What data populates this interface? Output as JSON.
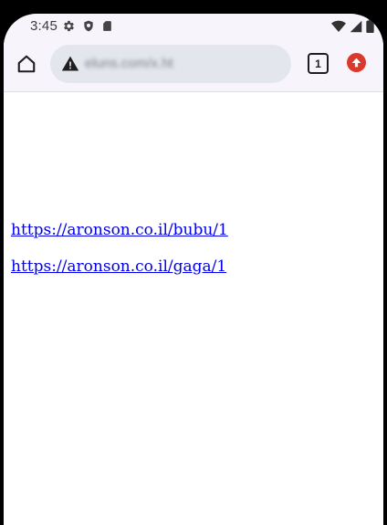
{
  "status_bar": {
    "time": "3:45",
    "left_icons": [
      "settings-icon",
      "shield-icon",
      "sd-card-icon"
    ],
    "right_icons": [
      "wifi-icon",
      "signal-icon",
      "battery-icon"
    ]
  },
  "toolbar": {
    "home_icon": "home-icon",
    "security_icon": "warning-icon",
    "url": "eluns.com/x.ht",
    "tab_count": "1",
    "update_icon": "update-arrow-icon",
    "update_color": "#d93a2b"
  },
  "page": {
    "links": [
      {
        "text": "https://aronson.co.il/bubu/1"
      },
      {
        "text": "https://aronson.co.il/gaga/1"
      }
    ],
    "link_color": "#0000ee"
  }
}
